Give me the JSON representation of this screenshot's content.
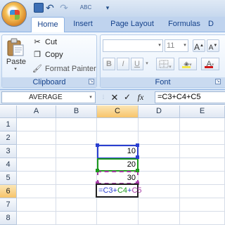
{
  "title_bar": {
    "quick_access": [
      "save-icon",
      "undo-icon",
      "redo-icon",
      "spelling-icon",
      "customize-qat-icon"
    ],
    "spell_glyph": "ABC",
    "undo_glyph": "↶",
    "redo_glyph": "↷",
    "more_glyph": "▾"
  },
  "tabs": [
    {
      "label": "Home",
      "active": true
    },
    {
      "label": "Insert",
      "active": false
    },
    {
      "label": "Page Layout",
      "active": false
    },
    {
      "label": "Formulas",
      "active": false
    },
    {
      "label": "D",
      "active": false
    }
  ],
  "clipboard": {
    "group_label": "Clipboard",
    "paste_label": "Paste",
    "cut_label": "Cut",
    "copy_label": "Copy",
    "format_painter_label": "Format Painter"
  },
  "font": {
    "group_label": "Font",
    "font_name": "",
    "font_size": "11",
    "bold_glyph": "B",
    "italic_glyph": "I",
    "underline_glyph": "U",
    "grow_glyph": "A",
    "shrink_glyph": "A",
    "fill_color": "#f5e84a",
    "font_color": "#d01818"
  },
  "formula_bar": {
    "name_box": "AVERAGE",
    "cancel_glyph": "✕",
    "enter_glyph": "✓",
    "fx_label": "fx",
    "formula": "=C3+C4+C5"
  },
  "sheet": {
    "columns": [
      "A",
      "B",
      "C",
      "D",
      "E"
    ],
    "rows": [
      "1",
      "2",
      "3",
      "4",
      "5",
      "6",
      "7",
      "8"
    ],
    "selected_column": "C",
    "selected_row": "6",
    "cells": {
      "C3": "10",
      "C4": "20",
      "C5": "30"
    },
    "editing_cell": {
      "ref": "C6",
      "tokens": [
        {
          "text": "=",
          "kind": "eq"
        },
        {
          "text": "C3",
          "kind": "c3"
        },
        {
          "text": "+",
          "kind": "plus"
        },
        {
          "text": "C4",
          "kind": "c4"
        },
        {
          "text": "+",
          "kind": "plus"
        },
        {
          "text": "C5",
          "kind": "c5"
        }
      ]
    },
    "reference_colors": {
      "C3": "#2a3fd0",
      "C4": "#1d9a1d",
      "C5": "#a63aa6"
    }
  }
}
